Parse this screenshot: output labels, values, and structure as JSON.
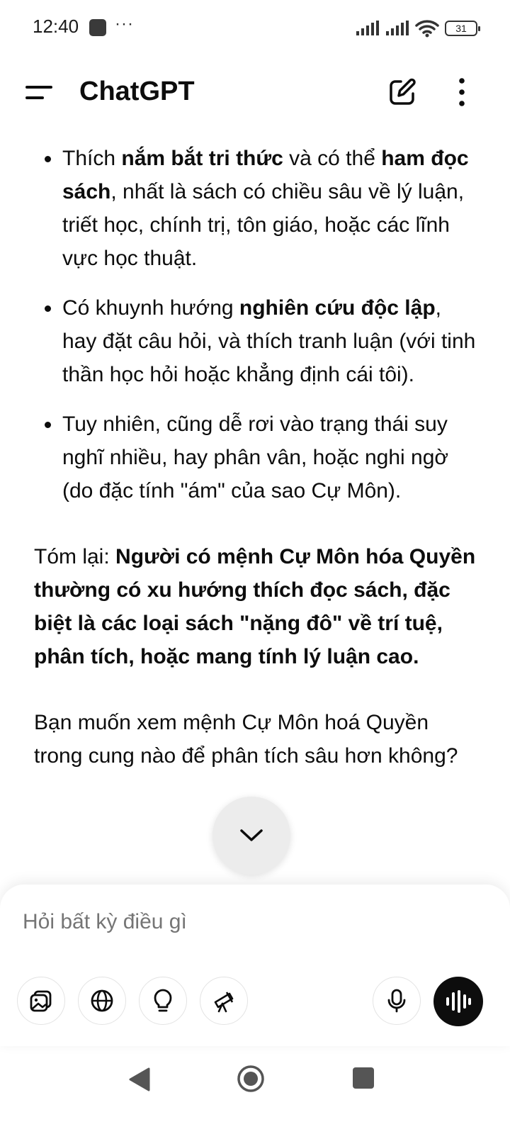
{
  "status_bar": {
    "time": "12:40",
    "overflow": "···",
    "battery": "31"
  },
  "app_bar": {
    "title": "ChatGPT"
  },
  "message": {
    "bullets": [
      {
        "parts": [
          {
            "text": "Thích ",
            "bold": false
          },
          {
            "text": "nắm bắt tri thức",
            "bold": true
          },
          {
            "text": " và có thể ",
            "bold": false
          },
          {
            "text": "ham đọc sách",
            "bold": true
          },
          {
            "text": ", nhất là sách có chiều sâu về lý luận, triết học, chính trị, tôn giáo, hoặc các lĩnh vực học thuật.",
            "bold": false
          }
        ]
      },
      {
        "parts": [
          {
            "text": "Có khuynh hướng ",
            "bold": false
          },
          {
            "text": "nghiên cứu độc lập",
            "bold": true
          },
          {
            "text": ", hay đặt câu hỏi, và thích tranh luận (với tinh thần học hỏi hoặc khẳng định cái tôi).",
            "bold": false
          }
        ]
      },
      {
        "parts": [
          {
            "text": "Tuy nhiên, cũng dễ rơi vào trạng thái suy nghĩ nhiều, hay phân vân, hoặc nghi ngờ (do đặc tính \"ám\" của sao Cự Môn).",
            "bold": false
          }
        ]
      }
    ],
    "summary_label": "Tóm lại: ",
    "summary_bold": "Người có mệnh Cự Môn hóa Quyền thường có xu hướng thích đọc sách, đặc biệt là các loại sách \"nặng đô\" về trí tuệ, phân tích, hoặc mang tính lý luận cao.",
    "question": "Bạn muốn xem mệnh Cự Môn hoá Quyền trong cung nào để phân tích sâu hơn không?"
  },
  "composer": {
    "placeholder": "Hỏi bất kỳ điều gì"
  },
  "icons": {
    "menu": "menu-icon",
    "edit": "edit-icon",
    "more": "more-vertical-icon",
    "scroll": "chevron-down-icon",
    "tools": [
      "image-icon",
      "globe-icon",
      "lightbulb-icon",
      "telescope-icon"
    ],
    "mic": "microphone-icon",
    "voice": "voice-waveform-icon"
  }
}
